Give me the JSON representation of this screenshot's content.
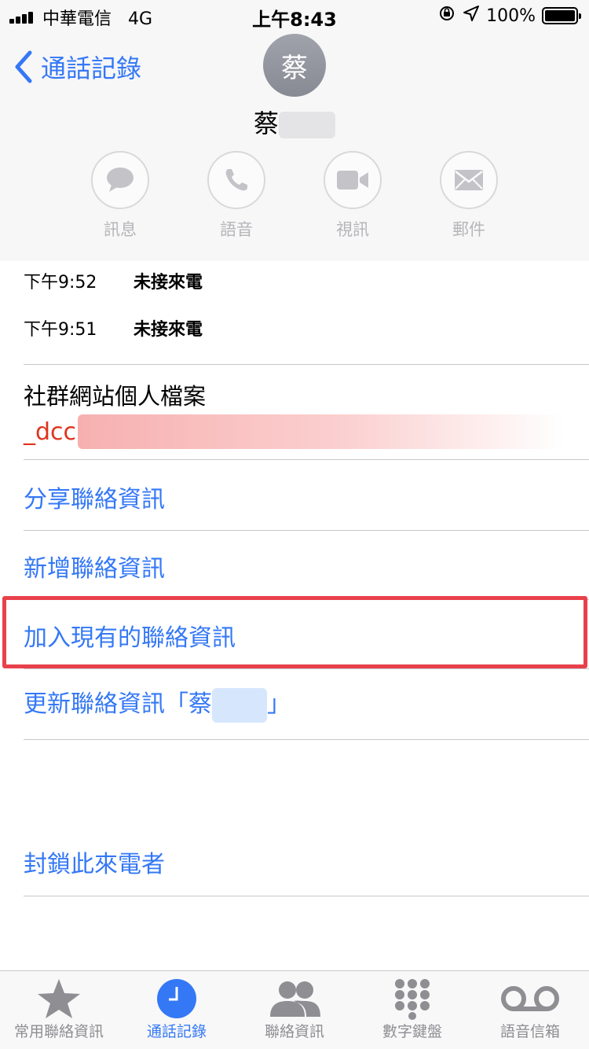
{
  "status_bar": {
    "carrier": "中華電信",
    "network": "4G",
    "time": "上午8:43",
    "battery": "100%"
  },
  "header": {
    "back_label": "通話記錄",
    "avatar_initial": "蔡",
    "contact_name": "蔡"
  },
  "actions": [
    {
      "label": "訊息",
      "icon": "message-icon"
    },
    {
      "label": "語音",
      "icon": "phone-icon"
    },
    {
      "label": "視訊",
      "icon": "video-icon"
    },
    {
      "label": "郵件",
      "icon": "mail-icon"
    }
  ],
  "calls": [
    {
      "time": "下午9:52",
      "type": "未接來電"
    },
    {
      "time": "下午9:51",
      "type": "未接來電"
    }
  ],
  "social": {
    "title": "社群網站個人檔案",
    "handle": "_dcc"
  },
  "options": {
    "share": "分享聯絡資訊",
    "new": "新增聯絡資訊",
    "add_existing": "加入現有的聯絡資訊",
    "update_prefix": "更新聯絡資訊「蔡",
    "update_suffix": "」",
    "block": "封鎖此來電者"
  },
  "tabs": [
    {
      "label": "常用聯絡資訊",
      "icon": "star-icon"
    },
    {
      "label": "通話記錄",
      "icon": "clock-icon",
      "active": true
    },
    {
      "label": "聯絡資訊",
      "icon": "contacts-icon"
    },
    {
      "label": "數字鍵盤",
      "icon": "keypad-icon"
    },
    {
      "label": "語音信箱",
      "icon": "voicemail-icon"
    }
  ],
  "colors": {
    "accent": "#3478f6",
    "social_red": "#e0331f",
    "highlight": "#e9414b"
  }
}
